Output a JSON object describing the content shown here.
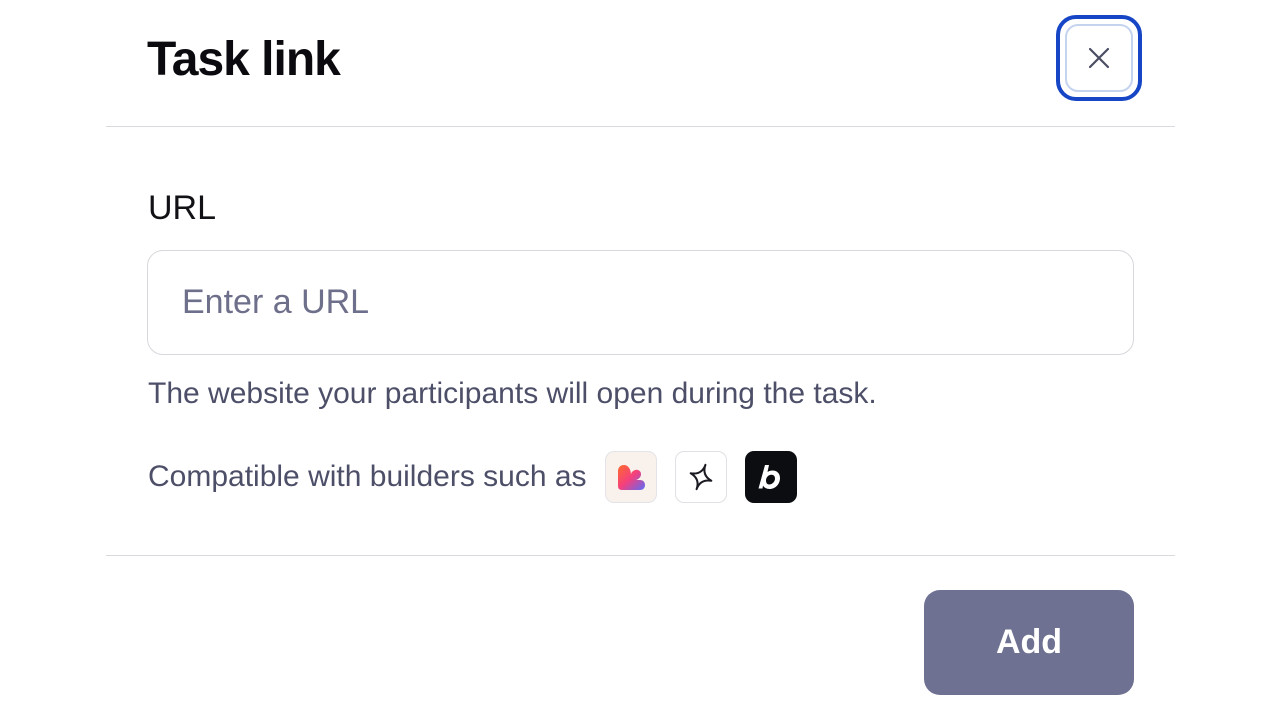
{
  "dialog": {
    "title": "Task link",
    "close_icon": "close-icon"
  },
  "url_field": {
    "label": "URL",
    "placeholder": "Enter a URL",
    "value": "",
    "help_text": "The website your participants will open during the task."
  },
  "compatibility": {
    "text": "Compatible with builders such as",
    "builders": [
      {
        "icon": "lovable-logo-icon",
        "background": "#f8f1ec"
      },
      {
        "icon": "sparkle-logo-icon",
        "background": "#ffffff"
      },
      {
        "icon": "bolt-logo-icon",
        "background": "#0c0d10"
      }
    ]
  },
  "footer": {
    "add_label": "Add"
  },
  "colors": {
    "focus_ring": "#1646c6",
    "add_button": "#6e7191",
    "muted_text": "#4d4f68"
  }
}
